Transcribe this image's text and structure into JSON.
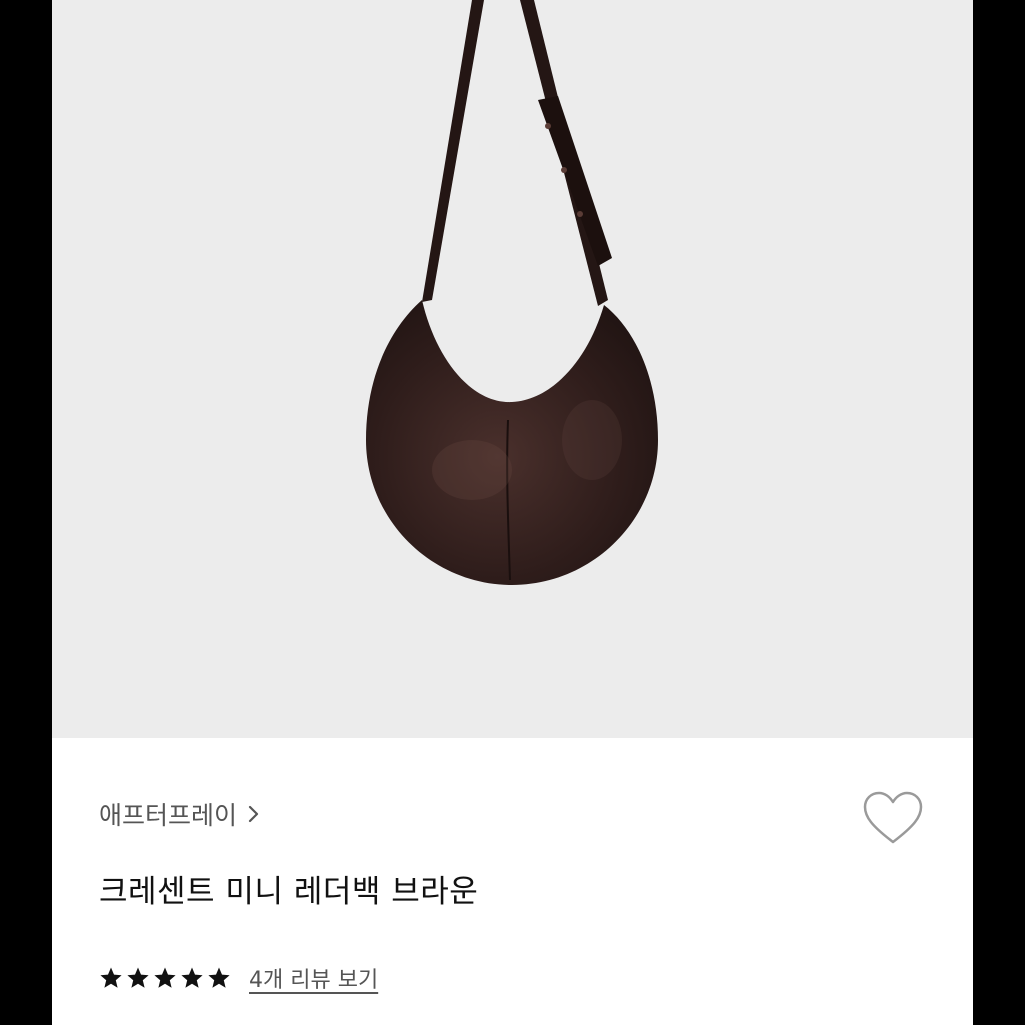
{
  "product": {
    "brand": "애프터프레이",
    "name": "크레센트 미니 레더백 브라운",
    "rating_stars": 5,
    "review_link": "4개 리뷰 보기",
    "image_subject": "crescent-leather-shoulder-bag"
  },
  "icons": {
    "brand_chevron": "chevron-right-icon",
    "wishlist": "heart-outline-icon",
    "star": "star-filled-icon"
  },
  "colors": {
    "image_background": "#ececec",
    "bag_leather": "#2f1d1b",
    "text_primary": "#111111",
    "text_secondary": "#555555",
    "star": "#111111"
  }
}
